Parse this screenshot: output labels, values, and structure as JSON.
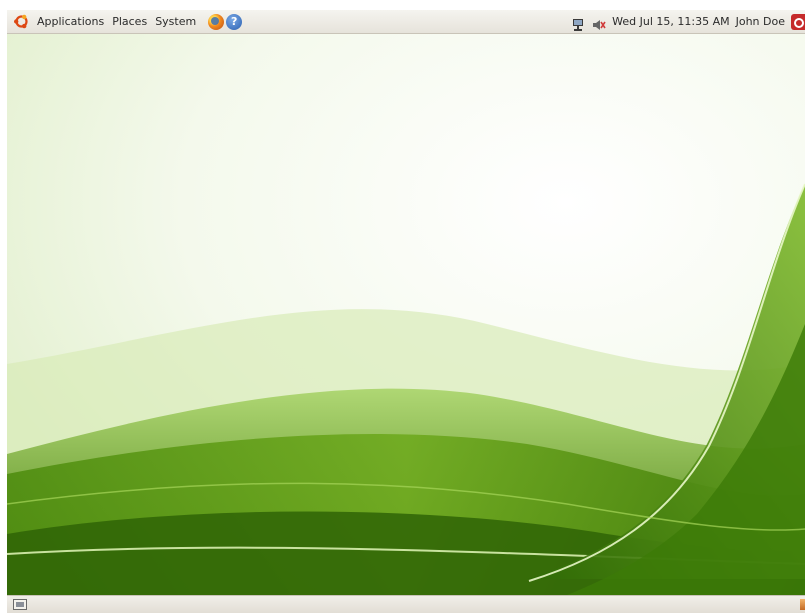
{
  "top_panel": {
    "menus": {
      "applications": "Applications",
      "places": "Places",
      "system": "System"
    },
    "launchers": {
      "firefox": "firefox-icon",
      "help": "?"
    },
    "tray": {
      "network": "network-icon",
      "volume": "volume-icon"
    },
    "clock": "Wed Jul 15, 11:35 AM",
    "user": "John Doe",
    "power": "power-icon"
  },
  "bottom_panel": {
    "show_desktop": "show-desktop-icon",
    "trash": "trash-icon"
  },
  "theme": {
    "wallpaper_greens": [
      "#2f6d06",
      "#5a9a12",
      "#8cc23e",
      "#c9e39a"
    ],
    "ubuntu_orange": "#dd4814",
    "panel_bg": "#eeece6"
  }
}
